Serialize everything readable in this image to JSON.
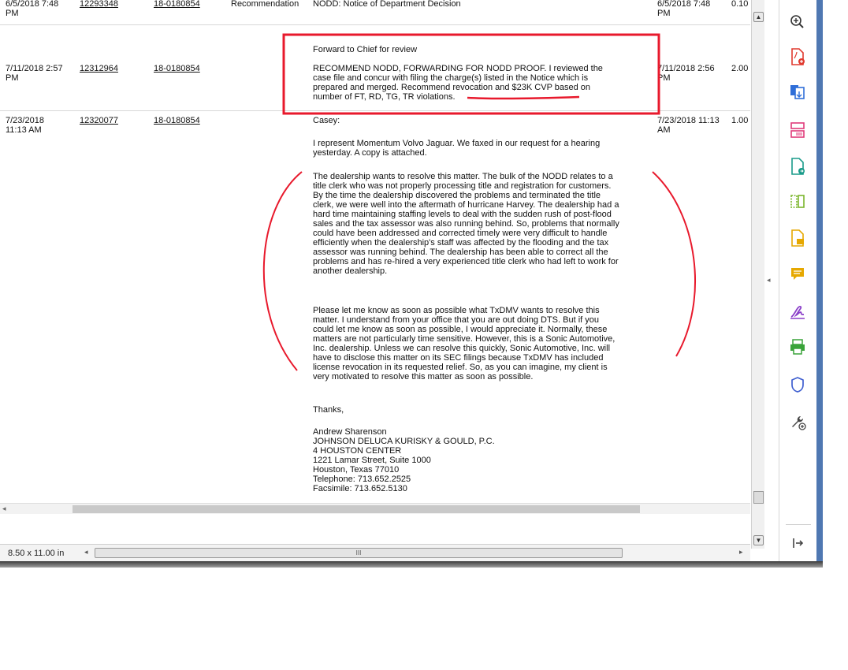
{
  "rows": [
    {
      "date": "6/5/2018 7:48\nPM",
      "id": "12293348",
      "case": "18-0180854",
      "type": "Recommendation",
      "text": "NODD: Notice of Department Decision",
      "date2": "6/5/2018 7:48\nPM",
      "hours": "0.10"
    },
    {
      "date": "7/11/2018 2:57\nPM",
      "id": "12312964",
      "case": "18-0180854",
      "pretext": "Forward to Chief for review",
      "text": "RECOMMEND NODD, FORWARDING FOR NODD PROOF. I reviewed the\ncase file and concur with filing the charge(s) listed in the Notice which is\nprepared and merged. Recommend revocation and $23K CVP based on\nnumber of FT, RD, TG, TR violations.",
      "date2": "7/11/2018 2:56\nPM",
      "hours": "2.00"
    },
    {
      "date": "7/23/2018\n11:13 AM",
      "id": "12320077",
      "case": "18-0180854",
      "date2": "7/23/2018 11:13\nAM",
      "hours": "1.00"
    }
  ],
  "letter": {
    "greeting": "Casey:",
    "p1": "I represent Momentum Volvo Jaguar. We faxed in our request for a hearing\nyesterday. A copy is attached.",
    "p2": "The dealership wants to resolve this matter. The bulk of the NODD relates to a\ntitle clerk who was not properly processing title and registration for customers.\nBy the time the dealership discovered the problems and terminated the title\nclerk, we were well into the aftermath of hurricane Harvey. The dealership had a\nhard time maintaining staffing levels to deal with the sudden rush of post-flood\nsales and the tax assessor was also running behind. So, problems that normally\ncould have been addressed and corrected timely were very difficult to handle\nefficiently when the dealership's staff was affected by the flooding and the tax\nassessor was running behind. The dealership has been able to correct all the\nproblems and has re-hired a very experienced title clerk who had left to work for\nanother dealership.",
    "p3": "Please let me know as soon as possible what TxDMV wants to resolve this\nmatter. I understand from your office that you are out doing DTS. But if you\ncould let me know as soon as possible, I would appreciate it. Normally, these\nmatters are not particularly time sensitive. However, this is a Sonic Automotive,\nInc. dealership. Unless we can resolve this quickly, Sonic Automotive, Inc. will\nhave to disclose this matter on its SEC filings because TxDMV has included\nlicense revocation in its requested relief. So, as you can imagine, my client is\nvery motivated to resolve this matter as soon as possible.",
    "thanks": "Thanks,",
    "signature": "Andrew Sharenson\nJOHNSON DELUCA KURISKY & GOULD, P.C.\n4 HOUSTON CENTER\n1221 Lamar Street, Suite 1000\nHouston, Texas 77010\nTelephone: 713.652.2525\nFacsimile: 713.652.5130"
  },
  "status": {
    "page_size": "8.50 x 11.00 in",
    "scroll_grip": "III"
  },
  "colors": {
    "annotation": "#e8192c",
    "tools_border": "#4f78b2"
  },
  "tools": [
    "zoom-in-icon",
    "create-pdf-icon",
    "export-pdf-icon",
    "organize-pages-icon",
    "edit-pdf-icon",
    "compare-files-icon",
    "comment-icon",
    "sticky-note-icon",
    "fill-sign-icon",
    "print-production-icon",
    "protect-icon",
    "more-tools-icon"
  ]
}
